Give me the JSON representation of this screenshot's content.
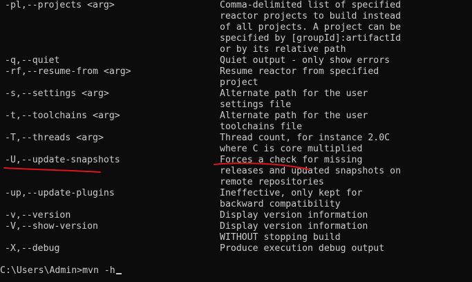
{
  "terminal": {
    "rows": [
      {
        "option": "-pl,--projects <arg>",
        "desc": "Comma-delimited list of specified"
      },
      {
        "option": "",
        "desc": "reactor projects to build instead"
      },
      {
        "option": "",
        "desc": "of all projects. A project can be"
      },
      {
        "option": "",
        "desc": "specified by [groupId]:artifactId"
      },
      {
        "option": "",
        "desc": "or by its relative path"
      },
      {
        "option": "-q,--quiet",
        "desc": "Quiet output - only show errors"
      },
      {
        "option": "-rf,--resume-from <arg>",
        "desc": "Resume reactor from specified"
      },
      {
        "option": "",
        "desc": "project"
      },
      {
        "option": "-s,--settings <arg>",
        "desc": "Alternate path for the user"
      },
      {
        "option": "",
        "desc": "settings file"
      },
      {
        "option": "-t,--toolchains <arg>",
        "desc": "Alternate path for the user"
      },
      {
        "option": "",
        "desc": "toolchains file"
      },
      {
        "option": "-T,--threads <arg>",
        "desc": "Thread count, for instance 2.0C"
      },
      {
        "option": "",
        "desc": "where C is core multiplied"
      },
      {
        "option": "-U,--update-snapshots",
        "desc": "Forces a check for missing"
      },
      {
        "option": "",
        "desc": "releases and updated snapshots on"
      },
      {
        "option": "",
        "desc": "remote repositories"
      },
      {
        "option": "-up,--update-plugins",
        "desc": "Ineffective, only kept for"
      },
      {
        "option": "",
        "desc": "backward compatibility"
      },
      {
        "option": "-v,--version",
        "desc": "Display version information"
      },
      {
        "option": "-V,--show-version",
        "desc": "Display version information"
      },
      {
        "option": "",
        "desc": "WITHOUT stopping build"
      },
      {
        "option": "-X,--debug",
        "desc": "Produce execution debug output"
      }
    ],
    "prompt": "C:\\Users\\Admin>mvn -h"
  },
  "colors": {
    "background": "#0c0c0c",
    "text": "#cccccc",
    "annotation": "#e0141e"
  }
}
